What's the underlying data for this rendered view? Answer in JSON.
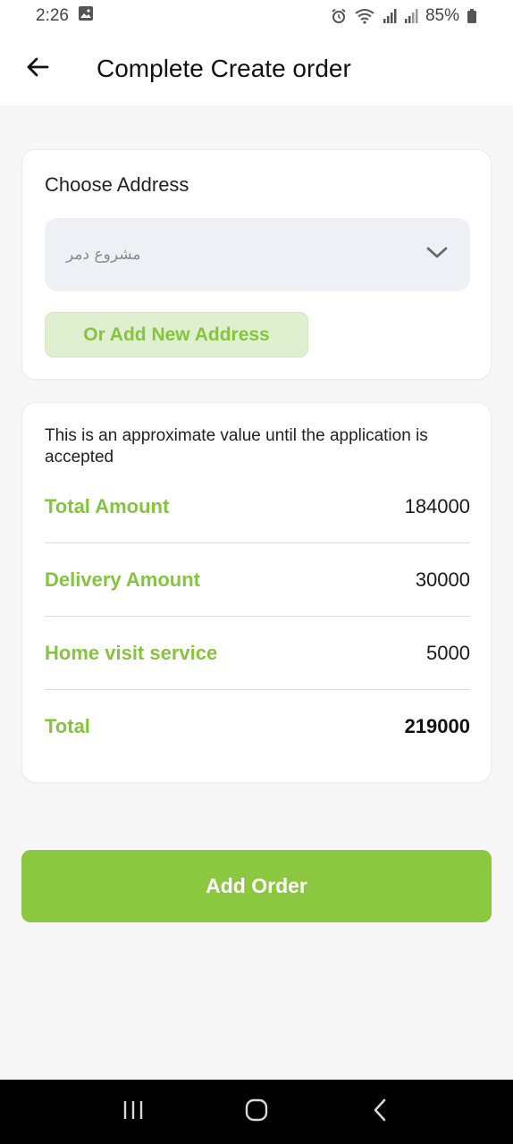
{
  "status_bar": {
    "time": "2:26",
    "battery": "85%",
    "icons": [
      "gallery-icon",
      "alarm-icon",
      "wifi-icon",
      "signal-icon",
      "signal-icon",
      "battery-icon"
    ]
  },
  "header": {
    "title": "Complete Create order",
    "back_icon": "arrow-left-icon"
  },
  "address": {
    "label": "Choose Address",
    "selected": "مشروع دمر",
    "add_new_label": "Or Add New Address"
  },
  "summary": {
    "note": "This is an approximate value until the application is accepted",
    "rows": [
      {
        "label": "Total Amount",
        "value": "184000"
      },
      {
        "label": "Delivery Amount",
        "value": "30000"
      },
      {
        "label": "Home visit service",
        "value": "5000"
      },
      {
        "label": "Total",
        "value": "219000"
      }
    ]
  },
  "actions": {
    "add_order_label": "Add Order"
  },
  "colors": {
    "accent": "#8bc83f",
    "accent_text": "#86c440",
    "accent_light": "#def0cf",
    "select_bg": "#eef0f5"
  }
}
